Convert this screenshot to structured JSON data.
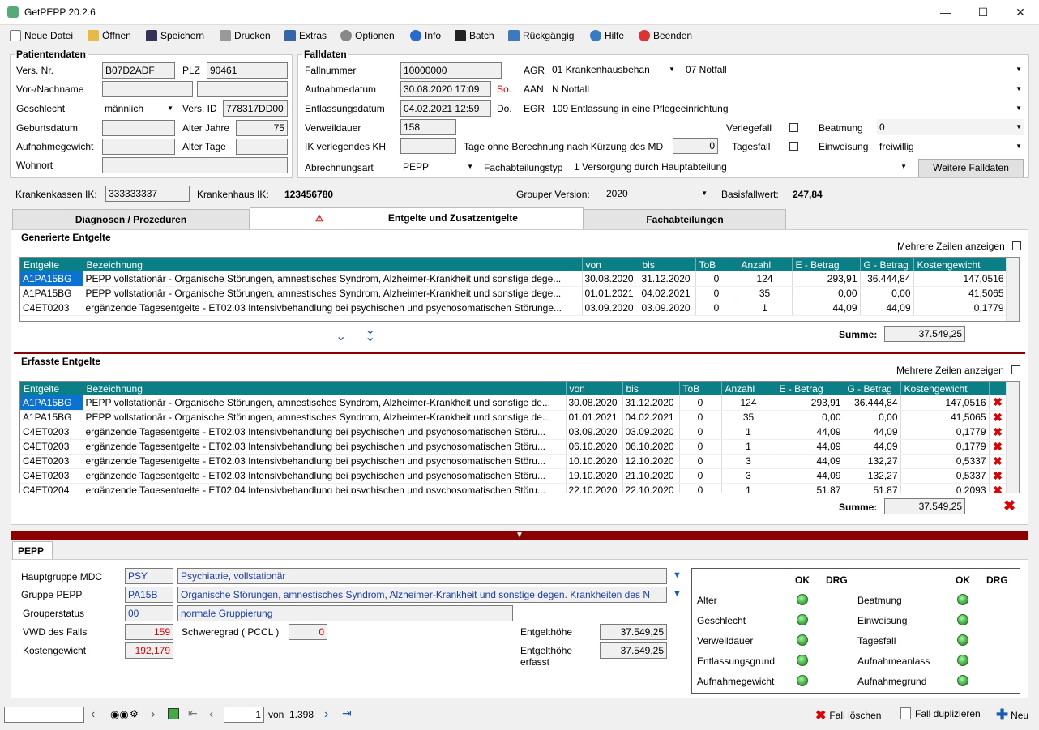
{
  "title": "GetPEPP 20.2.6",
  "menu": [
    {
      "label": "Neue Datei",
      "icon": "new-file-icon"
    },
    {
      "label": "Öffnen",
      "icon": "folder-open-icon"
    },
    {
      "label": "Speichern",
      "icon": "save-icon"
    },
    {
      "label": "Drucken",
      "icon": "print-icon"
    },
    {
      "label": "Extras",
      "icon": "extras-icon"
    },
    {
      "label": "Optionen",
      "icon": "options-icon"
    },
    {
      "label": "Info",
      "icon": "info-icon"
    },
    {
      "label": "Batch",
      "icon": "batch-icon"
    },
    {
      "label": "Rückgängig",
      "icon": "undo-icon"
    },
    {
      "label": "Hilfe",
      "icon": "help-icon"
    },
    {
      "label": "Beenden",
      "icon": "exit-icon"
    }
  ],
  "patient": {
    "legend": "Patientendaten",
    "vers_nr_label": "Vers. Nr.",
    "vers_nr": "B07D2ADF",
    "plz_label": "PLZ",
    "plz": "90461",
    "name_label": "Vor-/Nachname",
    "geschlecht_label": "Geschlecht",
    "geschlecht": "männlich",
    "vers_id_label": "Vers. ID",
    "vers_id": "778317DD00",
    "geburtsdatum_label": "Geburtsdatum",
    "alter_jahre_label": "Alter Jahre",
    "alter_jahre": "75",
    "aufnahmegewicht_label": "Aufnahmegewicht",
    "alter_tage_label": "Alter Tage",
    "wohnort_label": "Wohnort"
  },
  "fall": {
    "legend": "Falldaten",
    "fallnummer_label": "Fallnummer",
    "fallnummer": "10000000",
    "aufnahme_label": "Aufnahmedatum",
    "aufnahme": "30.08.2020 17:09",
    "aufnahme_day": "So.",
    "entlassung_label": "Entlassungsdatum",
    "entlassung": "04.02.2021 12:59",
    "entlassung_day": "Do.",
    "verweildauer_label": "Verweildauer",
    "verweildauer": "158",
    "ik_label": "IK verlegendes KH",
    "tage_ohne_label": "Tage ohne Berechnung nach Kürzung des MD",
    "tage_ohne": "0",
    "abrechnungsart_label": "Abrechnungsart",
    "abrechnungsart": "PEPP",
    "fachabteilungstyp_label": "Fachabteilungstyp",
    "fachabteilungstyp": "1  Versorgung durch Hauptabteilung",
    "agr_label": "AGR",
    "agr1": "01  Krankenhausbehan",
    "agr2": "07  Notfall",
    "aan_label": "AAN",
    "aan": "N  Notfall",
    "egr_label": "EGR",
    "egr": "109  Entlassung in eine Pflegeeinrichtung",
    "verlegefall_label": "Verlegefall",
    "tagesfall_label": "Tagesfall",
    "beatmung_label": "Beatmung",
    "beatmung": "0",
    "einweisung_label": "Einweisung",
    "einweisung": "freiwillig",
    "weitere_button": "Weitere Falldaten"
  },
  "info_row": {
    "kk_ik_label": "Krankenkassen IK:",
    "kk_ik": "333333337",
    "kh_label": "Krankenhaus IK:",
    "kh": "123456780",
    "grouper_label": "Grouper Version:",
    "grouper": "2020",
    "basis_label": "Basisfallwert:",
    "basis": "247,84"
  },
  "tabs": [
    "Diagnosen / Prozeduren",
    "Entgelte und Zusatzentgelte",
    "Fachabteilungen"
  ],
  "generated": {
    "title": "Generierte Entgelte",
    "mehrere": "Mehrere Zeilen anzeigen",
    "columns": [
      "Entgelte",
      "Bezeichnung",
      "von",
      "bis",
      "ToB",
      "Anzahl",
      "E - Betrag",
      "G - Betrag",
      "Kostengewicht"
    ],
    "rows": [
      [
        "A1PA15BG",
        "PEPP vollstationär - Organische Störungen, amnestisches Syndrom, Alzheimer-Krankheit und sonstige dege...",
        "30.08.2020",
        "31.12.2020",
        "0",
        "124",
        "293,91",
        "36.444,84",
        "147,0516"
      ],
      [
        "A1PA15BG",
        "PEPP vollstationär - Organische Störungen, amnestisches Syndrom, Alzheimer-Krankheit und sonstige dege...",
        "01.01.2021",
        "04.02.2021",
        "0",
        "35",
        "0,00",
        "0,00",
        "41,5065"
      ],
      [
        "C4ET0203",
        "ergänzende Tagesentgelte - ET02.03 Intensivbehandlung bei psychischen und psychosomatischen Störunge...",
        "03.09.2020",
        "03.09.2020",
        "0",
        "1",
        "44,09",
        "44,09",
        "0,1779"
      ]
    ],
    "summe_label": "Summe:",
    "summe": "37.549,25"
  },
  "erfasst": {
    "title": "Erfasste Entgelte",
    "mehrere": "Mehrere Zeilen anzeigen",
    "columns": [
      "Entgelte",
      "Bezeichnung",
      "von",
      "bis",
      "ToB",
      "Anzahl",
      "E - Betrag",
      "G - Betrag",
      "Kostengewicht"
    ],
    "rows": [
      [
        "A1PA15BG",
        "PEPP vollstationär - Organische Störungen, amnestisches Syndrom, Alzheimer-Krankheit und sonstige de...",
        "30.08.2020",
        "31.12.2020",
        "0",
        "124",
        "293,91",
        "36.444,84",
        "147,0516"
      ],
      [
        "A1PA15BG",
        "PEPP vollstationär - Organische Störungen, amnestisches Syndrom, Alzheimer-Krankheit und sonstige de...",
        "01.01.2021",
        "04.02.2021",
        "0",
        "35",
        "0,00",
        "0,00",
        "41,5065"
      ],
      [
        "C4ET0203",
        "ergänzende Tagesentgelte - ET02.03 Intensivbehandlung bei psychischen und psychosomatischen Störu...",
        "03.09.2020",
        "03.09.2020",
        "0",
        "1",
        "44,09",
        "44,09",
        "0,1779"
      ],
      [
        "C4ET0203",
        "ergänzende Tagesentgelte - ET02.03 Intensivbehandlung bei psychischen und psychosomatischen Störu...",
        "06.10.2020",
        "06.10.2020",
        "0",
        "1",
        "44,09",
        "44,09",
        "0,1779"
      ],
      [
        "C4ET0203",
        "ergänzende Tagesentgelte - ET02.03 Intensivbehandlung bei psychischen und psychosomatischen Störu...",
        "10.10.2020",
        "12.10.2020",
        "0",
        "3",
        "44,09",
        "132,27",
        "0,5337"
      ],
      [
        "C4ET0203",
        "ergänzende Tagesentgelte - ET02.03 Intensivbehandlung bei psychischen und psychosomatischen Störu...",
        "19.10.2020",
        "21.10.2020",
        "0",
        "3",
        "44,09",
        "132,27",
        "0,5337"
      ],
      [
        "C4ET0204",
        "ergänzende Tagesentgelte - ET02.04 Intensivbehandlung bei psychischen und psychosomatischen Störu...",
        "22.10.2020",
        "22.10.2020",
        "0",
        "1",
        "51,87",
        "51,87",
        "0,2093"
      ]
    ],
    "summe_label": "Summe:",
    "summe": "37.549,25"
  },
  "pepp": {
    "tab": "PEPP",
    "hauptgruppe_label": "Hauptgruppe MDC",
    "hauptgruppe_code": "PSY",
    "hauptgruppe_text": "Psychiatrie, vollstationär",
    "gruppe_label": "Gruppe PEPP",
    "gruppe_code": "PA15B",
    "gruppe_text": "Organische Störungen, amnestisches Syndrom, Alzheimer-Krankheit und sonstige degen. Krankheiten des N",
    "status_label": "Grouperstatus",
    "status_code": "00",
    "status_text": "normale Gruppierung",
    "vwd_label": "VWD des Falls",
    "vwd": "159",
    "schweregrad_label": "Schweregrad ( PCCL )",
    "schweregrad": "0",
    "kg_label": "Kostengewicht",
    "kg": "192,179",
    "entgelthoehe_label": "Entgelthöhe",
    "entgelthoehe": "37.549,25",
    "entgelthoehe_erfasst_label": "Entgelthöhe erfasst",
    "entgelthoehe_erfasst": "37.549,25",
    "checks_header": {
      "ok": "OK",
      "drg": "DRG"
    },
    "checks_left": [
      "Alter",
      "Geschlecht",
      "Verweildauer",
      "Entlassungsgrund",
      "Aufnahmegewicht"
    ],
    "checks_right": [
      "Beatmung",
      "Einweisung",
      "Tagesfall",
      "Aufnahmeanlass",
      "Aufnahmegrund"
    ]
  },
  "footer": {
    "page": "1",
    "von_label": "von",
    "total": "1.398",
    "fall_loeschen": "Fall löschen",
    "fall_duplizieren": "Fall duplizieren",
    "neu": "Neu"
  },
  "colors": {
    "header": "#0a7f86",
    "divider": "#8b0000",
    "select": "#0a72d0"
  }
}
